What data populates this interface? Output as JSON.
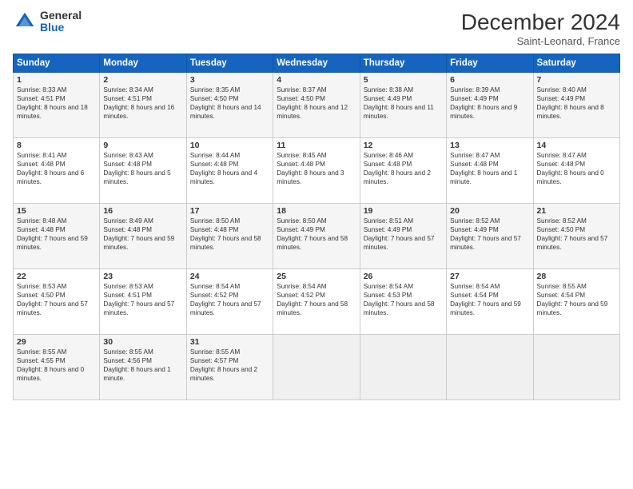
{
  "header": {
    "logo_general": "General",
    "logo_blue": "Blue",
    "month_title": "December 2024",
    "subtitle": "Saint-Leonard, France"
  },
  "days_of_week": [
    "Sunday",
    "Monday",
    "Tuesday",
    "Wednesday",
    "Thursday",
    "Friday",
    "Saturday"
  ],
  "weeks": [
    [
      {
        "day": 1,
        "sunrise": "Sunrise: 8:33 AM",
        "sunset": "Sunset: 4:51 PM",
        "daylight": "Daylight: 8 hours and 18 minutes."
      },
      {
        "day": 2,
        "sunrise": "Sunrise: 8:34 AM",
        "sunset": "Sunset: 4:51 PM",
        "daylight": "Daylight: 8 hours and 16 minutes."
      },
      {
        "day": 3,
        "sunrise": "Sunrise: 8:35 AM",
        "sunset": "Sunset: 4:50 PM",
        "daylight": "Daylight: 8 hours and 14 minutes."
      },
      {
        "day": 4,
        "sunrise": "Sunrise: 8:37 AM",
        "sunset": "Sunset: 4:50 PM",
        "daylight": "Daylight: 8 hours and 12 minutes."
      },
      {
        "day": 5,
        "sunrise": "Sunrise: 8:38 AM",
        "sunset": "Sunset: 4:49 PM",
        "daylight": "Daylight: 8 hours and 11 minutes."
      },
      {
        "day": 6,
        "sunrise": "Sunrise: 8:39 AM",
        "sunset": "Sunset: 4:49 PM",
        "daylight": "Daylight: 8 hours and 9 minutes."
      },
      {
        "day": 7,
        "sunrise": "Sunrise: 8:40 AM",
        "sunset": "Sunset: 4:49 PM",
        "daylight": "Daylight: 8 hours and 8 minutes."
      }
    ],
    [
      {
        "day": 8,
        "sunrise": "Sunrise: 8:41 AM",
        "sunset": "Sunset: 4:48 PM",
        "daylight": "Daylight: 8 hours and 6 minutes."
      },
      {
        "day": 9,
        "sunrise": "Sunrise: 8:43 AM",
        "sunset": "Sunset: 4:48 PM",
        "daylight": "Daylight: 8 hours and 5 minutes."
      },
      {
        "day": 10,
        "sunrise": "Sunrise: 8:44 AM",
        "sunset": "Sunset: 4:48 PM",
        "daylight": "Daylight: 8 hours and 4 minutes."
      },
      {
        "day": 11,
        "sunrise": "Sunrise: 8:45 AM",
        "sunset": "Sunset: 4:48 PM",
        "daylight": "Daylight: 8 hours and 3 minutes."
      },
      {
        "day": 12,
        "sunrise": "Sunrise: 8:46 AM",
        "sunset": "Sunset: 4:48 PM",
        "daylight": "Daylight: 8 hours and 2 minutes."
      },
      {
        "day": 13,
        "sunrise": "Sunrise: 8:47 AM",
        "sunset": "Sunset: 4:48 PM",
        "daylight": "Daylight: 8 hours and 1 minute."
      },
      {
        "day": 14,
        "sunrise": "Sunrise: 8:47 AM",
        "sunset": "Sunset: 4:48 PM",
        "daylight": "Daylight: 8 hours and 0 minutes."
      }
    ],
    [
      {
        "day": 15,
        "sunrise": "Sunrise: 8:48 AM",
        "sunset": "Sunset: 4:48 PM",
        "daylight": "Daylight: 7 hours and 59 minutes."
      },
      {
        "day": 16,
        "sunrise": "Sunrise: 8:49 AM",
        "sunset": "Sunset: 4:48 PM",
        "daylight": "Daylight: 7 hours and 59 minutes."
      },
      {
        "day": 17,
        "sunrise": "Sunrise: 8:50 AM",
        "sunset": "Sunset: 4:48 PM",
        "daylight": "Daylight: 7 hours and 58 minutes."
      },
      {
        "day": 18,
        "sunrise": "Sunrise: 8:50 AM",
        "sunset": "Sunset: 4:49 PM",
        "daylight": "Daylight: 7 hours and 58 minutes."
      },
      {
        "day": 19,
        "sunrise": "Sunrise: 8:51 AM",
        "sunset": "Sunset: 4:49 PM",
        "daylight": "Daylight: 7 hours and 57 minutes."
      },
      {
        "day": 20,
        "sunrise": "Sunrise: 8:52 AM",
        "sunset": "Sunset: 4:49 PM",
        "daylight": "Daylight: 7 hours and 57 minutes."
      },
      {
        "day": 21,
        "sunrise": "Sunrise: 8:52 AM",
        "sunset": "Sunset: 4:50 PM",
        "daylight": "Daylight: 7 hours and 57 minutes."
      }
    ],
    [
      {
        "day": 22,
        "sunrise": "Sunrise: 8:53 AM",
        "sunset": "Sunset: 4:50 PM",
        "daylight": "Daylight: 7 hours and 57 minutes."
      },
      {
        "day": 23,
        "sunrise": "Sunrise: 8:53 AM",
        "sunset": "Sunset: 4:51 PM",
        "daylight": "Daylight: 7 hours and 57 minutes."
      },
      {
        "day": 24,
        "sunrise": "Sunrise: 8:54 AM",
        "sunset": "Sunset: 4:52 PM",
        "daylight": "Daylight: 7 hours and 57 minutes."
      },
      {
        "day": 25,
        "sunrise": "Sunrise: 8:54 AM",
        "sunset": "Sunset: 4:52 PM",
        "daylight": "Daylight: 7 hours and 58 minutes."
      },
      {
        "day": 26,
        "sunrise": "Sunrise: 8:54 AM",
        "sunset": "Sunset: 4:53 PM",
        "daylight": "Daylight: 7 hours and 58 minutes."
      },
      {
        "day": 27,
        "sunrise": "Sunrise: 8:54 AM",
        "sunset": "Sunset: 4:54 PM",
        "daylight": "Daylight: 7 hours and 59 minutes."
      },
      {
        "day": 28,
        "sunrise": "Sunrise: 8:55 AM",
        "sunset": "Sunset: 4:54 PM",
        "daylight": "Daylight: 7 hours and 59 minutes."
      }
    ],
    [
      {
        "day": 29,
        "sunrise": "Sunrise: 8:55 AM",
        "sunset": "Sunset: 4:55 PM",
        "daylight": "Daylight: 8 hours and 0 minutes."
      },
      {
        "day": 30,
        "sunrise": "Sunrise: 8:55 AM",
        "sunset": "Sunset: 4:56 PM",
        "daylight": "Daylight: 8 hours and 1 minute."
      },
      {
        "day": 31,
        "sunrise": "Sunrise: 8:55 AM",
        "sunset": "Sunset: 4:57 PM",
        "daylight": "Daylight: 8 hours and 2 minutes."
      },
      null,
      null,
      null,
      null
    ]
  ]
}
